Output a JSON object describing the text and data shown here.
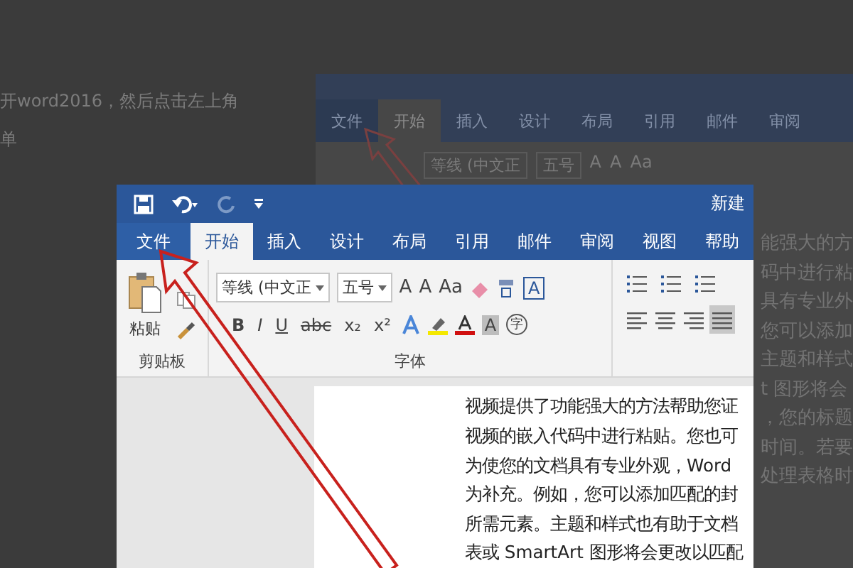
{
  "background_page": {
    "paragraph_lines": [
      "开word2016，然后点击左上角",
      "单"
    ],
    "screenshot": {
      "tabs": [
        {
          "label": "文件",
          "kind": "file",
          "selected": false
        },
        {
          "label": "开始",
          "kind": "tab",
          "selected": true
        },
        {
          "label": "插入",
          "kind": "tab",
          "selected": false
        },
        {
          "label": "设计",
          "kind": "tab",
          "selected": false
        },
        {
          "label": "布局",
          "kind": "tab",
          "selected": false
        },
        {
          "label": "引用",
          "kind": "tab",
          "selected": false
        },
        {
          "label": "邮件",
          "kind": "tab",
          "selected": false
        },
        {
          "label": "审阅",
          "kind": "tab",
          "selected": false
        }
      ],
      "font_name": "等线 (中文正",
      "font_size": "五号",
      "grow_label": "A",
      "shrink_label": "A",
      "case_label": "Aa",
      "text_lines": [
        "能强大的方",
        "码中进行粘",
        "具有专业外",
        "您可以添加",
        "主题和样式",
        "t 图形将会",
        "，您的标题",
        "时间。若要",
        "处理表格时"
      ]
    }
  },
  "window": {
    "title": "新建",
    "tabs": [
      {
        "label": "文件",
        "kind": "file",
        "selected": false
      },
      {
        "label": "开始",
        "kind": "tab",
        "selected": true
      },
      {
        "label": "插入",
        "kind": "tab",
        "selected": false
      },
      {
        "label": "设计",
        "kind": "tab",
        "selected": false
      },
      {
        "label": "布局",
        "kind": "tab",
        "selected": false
      },
      {
        "label": "引用",
        "kind": "tab",
        "selected": false
      },
      {
        "label": "邮件",
        "kind": "tab",
        "selected": false
      },
      {
        "label": "审阅",
        "kind": "tab",
        "selected": false
      },
      {
        "label": "视图",
        "kind": "tab",
        "selected": false
      },
      {
        "label": "帮助",
        "kind": "tab",
        "selected": false
      }
    ],
    "clipboard": {
      "paste_label": "粘贴",
      "group_label": "剪贴板"
    },
    "font": {
      "font_name": "等线 (中文正",
      "font_size": "五号",
      "grow_label": "A",
      "shrink_label": "A",
      "case_label": "Aa",
      "boxed_label": "A",
      "format_buttons": [
        {
          "label": "B",
          "kind": "bold"
        },
        {
          "label": "I",
          "kind": "italic"
        },
        {
          "label": "U",
          "kind": "underline"
        },
        {
          "label": "abc",
          "kind": "strike"
        },
        {
          "label": "x₂",
          "kind": "sub"
        },
        {
          "label": "x²",
          "kind": "sup"
        }
      ],
      "shade_label": "A",
      "enclose_label": "字",
      "group_label": "字体"
    },
    "paragraph": {
      "alignments": [
        {
          "kind": "left",
          "selected": false
        },
        {
          "kind": "center",
          "selected": false
        },
        {
          "kind": "right",
          "selected": false
        },
        {
          "kind": "justify",
          "selected": true
        }
      ]
    },
    "document": {
      "lines": [
        "视频提供了功能强大的方法帮助您证",
        "视频的嵌入代码中进行粘贴。您也可",
        "为使您的文档具有专业外观，Word",
        "为补充。例如，您可以添加匹配的封",
        "所需元素。主题和样式也有助于文档",
        "表或 SmartArt 图形将会更改以匹配"
      ]
    }
  }
}
